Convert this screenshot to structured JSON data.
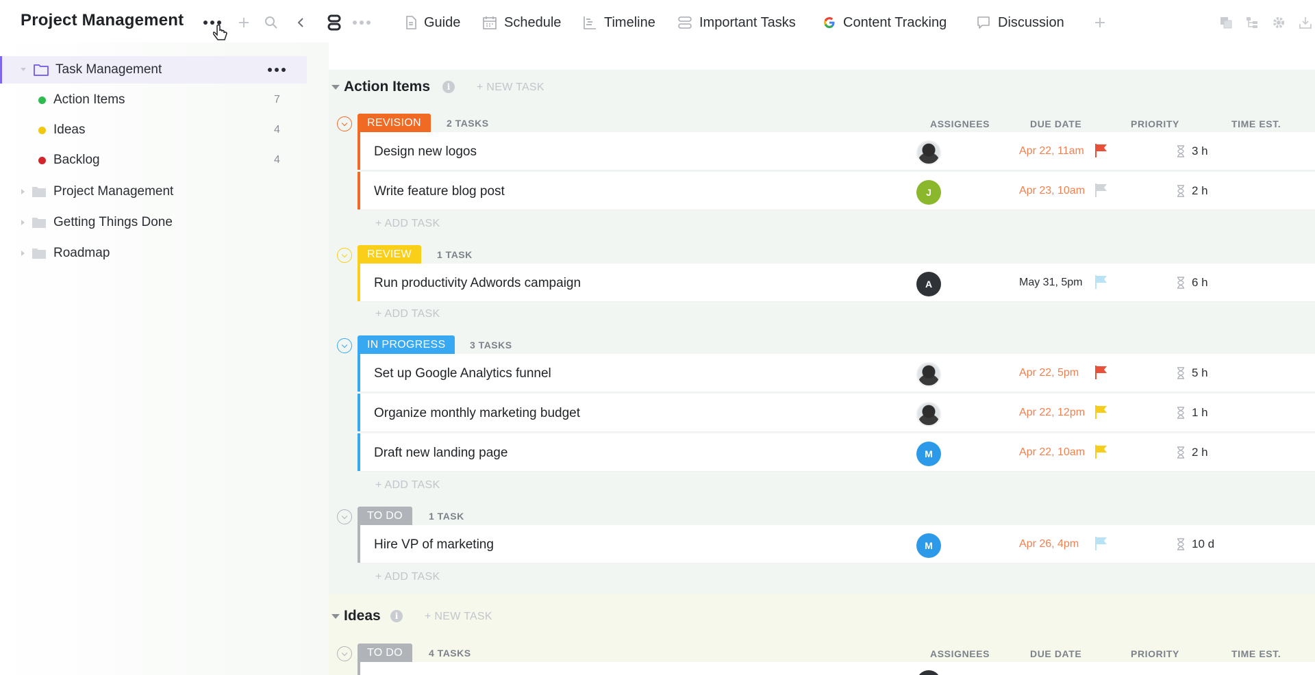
{
  "header": {
    "title": "Project Management",
    "view_tabs": [
      {
        "label": "Guide",
        "icon": "document-icon"
      },
      {
        "label": "Schedule",
        "icon": "calendar-icon"
      },
      {
        "label": "Timeline",
        "icon": "timeline-icon"
      },
      {
        "label": "Important Tasks",
        "icon": "list-view-icon"
      },
      {
        "label": "Content Tracking",
        "icon": "google-icon"
      },
      {
        "label": "Discussion",
        "icon": "chat-icon"
      }
    ]
  },
  "sidebar": {
    "folder": "Task Management",
    "lists": [
      {
        "label": "Action Items",
        "count": "7",
        "color": "#2fbb4f"
      },
      {
        "label": "Ideas",
        "count": "4",
        "color": "#f2c711"
      },
      {
        "label": "Backlog",
        "count": "4",
        "color": "#d0262c"
      }
    ],
    "folders": [
      "Project Management",
      "Getting Things Done",
      "Roadmap"
    ]
  },
  "main": {
    "new_task_label": "+ NEW TASK",
    "add_task_label": "+ ADD TASK",
    "columns": {
      "assignees": "ASSIGNEES",
      "due_date": "DUE DATE",
      "priority": "PRIORITY",
      "time_est": "TIME EST."
    },
    "lists": [
      {
        "title": "Action Items",
        "groups": [
          {
            "status": "REVISION",
            "count": "2 TASKS",
            "color": "#f06a23",
            "tasks": [
              {
                "name": "Design new logos",
                "assignee": "photo",
                "due": "Apr 22, 11am",
                "due_color": "#f2804f",
                "flag": "#e8503a",
                "time": "3 h"
              },
              {
                "name": "Write feature blog post",
                "assignee": "J",
                "assignee_color": "#8ab72b",
                "due": "Apr 23, 10am",
                "due_color": "#f2804f",
                "flag": "#d0d3d8",
                "time": "2 h"
              }
            ]
          },
          {
            "status": "REVIEW",
            "count": "1 TASK",
            "color": "#f9cf1a",
            "tasks": [
              {
                "name": "Run productivity Adwords campaign",
                "assignee": "A",
                "assignee_color": "#2f3337",
                "due": "May 31, 5pm",
                "due_color": "#2a2e34",
                "flag": "#b7e3f5",
                "time": "6 h"
              }
            ]
          },
          {
            "status": "IN PROGRESS",
            "count": "3 TASKS",
            "color": "#38a8f2",
            "tasks": [
              {
                "name": "Set up Google Analytics funnel",
                "assignee": "photo",
                "due": "Apr 22, 5pm",
                "due_color": "#f2804f",
                "flag": "#e8503a",
                "time": "5 h"
              },
              {
                "name": "Organize monthly marketing budget",
                "assignee": "photo",
                "due": "Apr 22, 12pm",
                "due_color": "#f2804f",
                "flag": "#f4cd1d",
                "time": "1 h"
              },
              {
                "name": "Draft new landing page",
                "assignee": "M",
                "assignee_color": "#2c9ae8",
                "due": "Apr 22, 10am",
                "due_color": "#f2804f",
                "flag": "#f4cd1d",
                "time": "2 h"
              }
            ]
          },
          {
            "status": "TO DO",
            "count": "1 TASK",
            "color": "#b0b3b8",
            "tasks": [
              {
                "name": "Hire VP of marketing",
                "assignee": "M",
                "assignee_color": "#2c9ae8",
                "due": "Apr 26, 4pm",
                "due_color": "#f2804f",
                "flag": "#b7e3f5",
                "time": "10 d"
              }
            ]
          }
        ]
      },
      {
        "title": "Ideas",
        "groups": [
          {
            "status": "TO DO",
            "count": "4 TASKS",
            "color": "#b0b3b8",
            "tasks": []
          }
        ]
      }
    ]
  }
}
